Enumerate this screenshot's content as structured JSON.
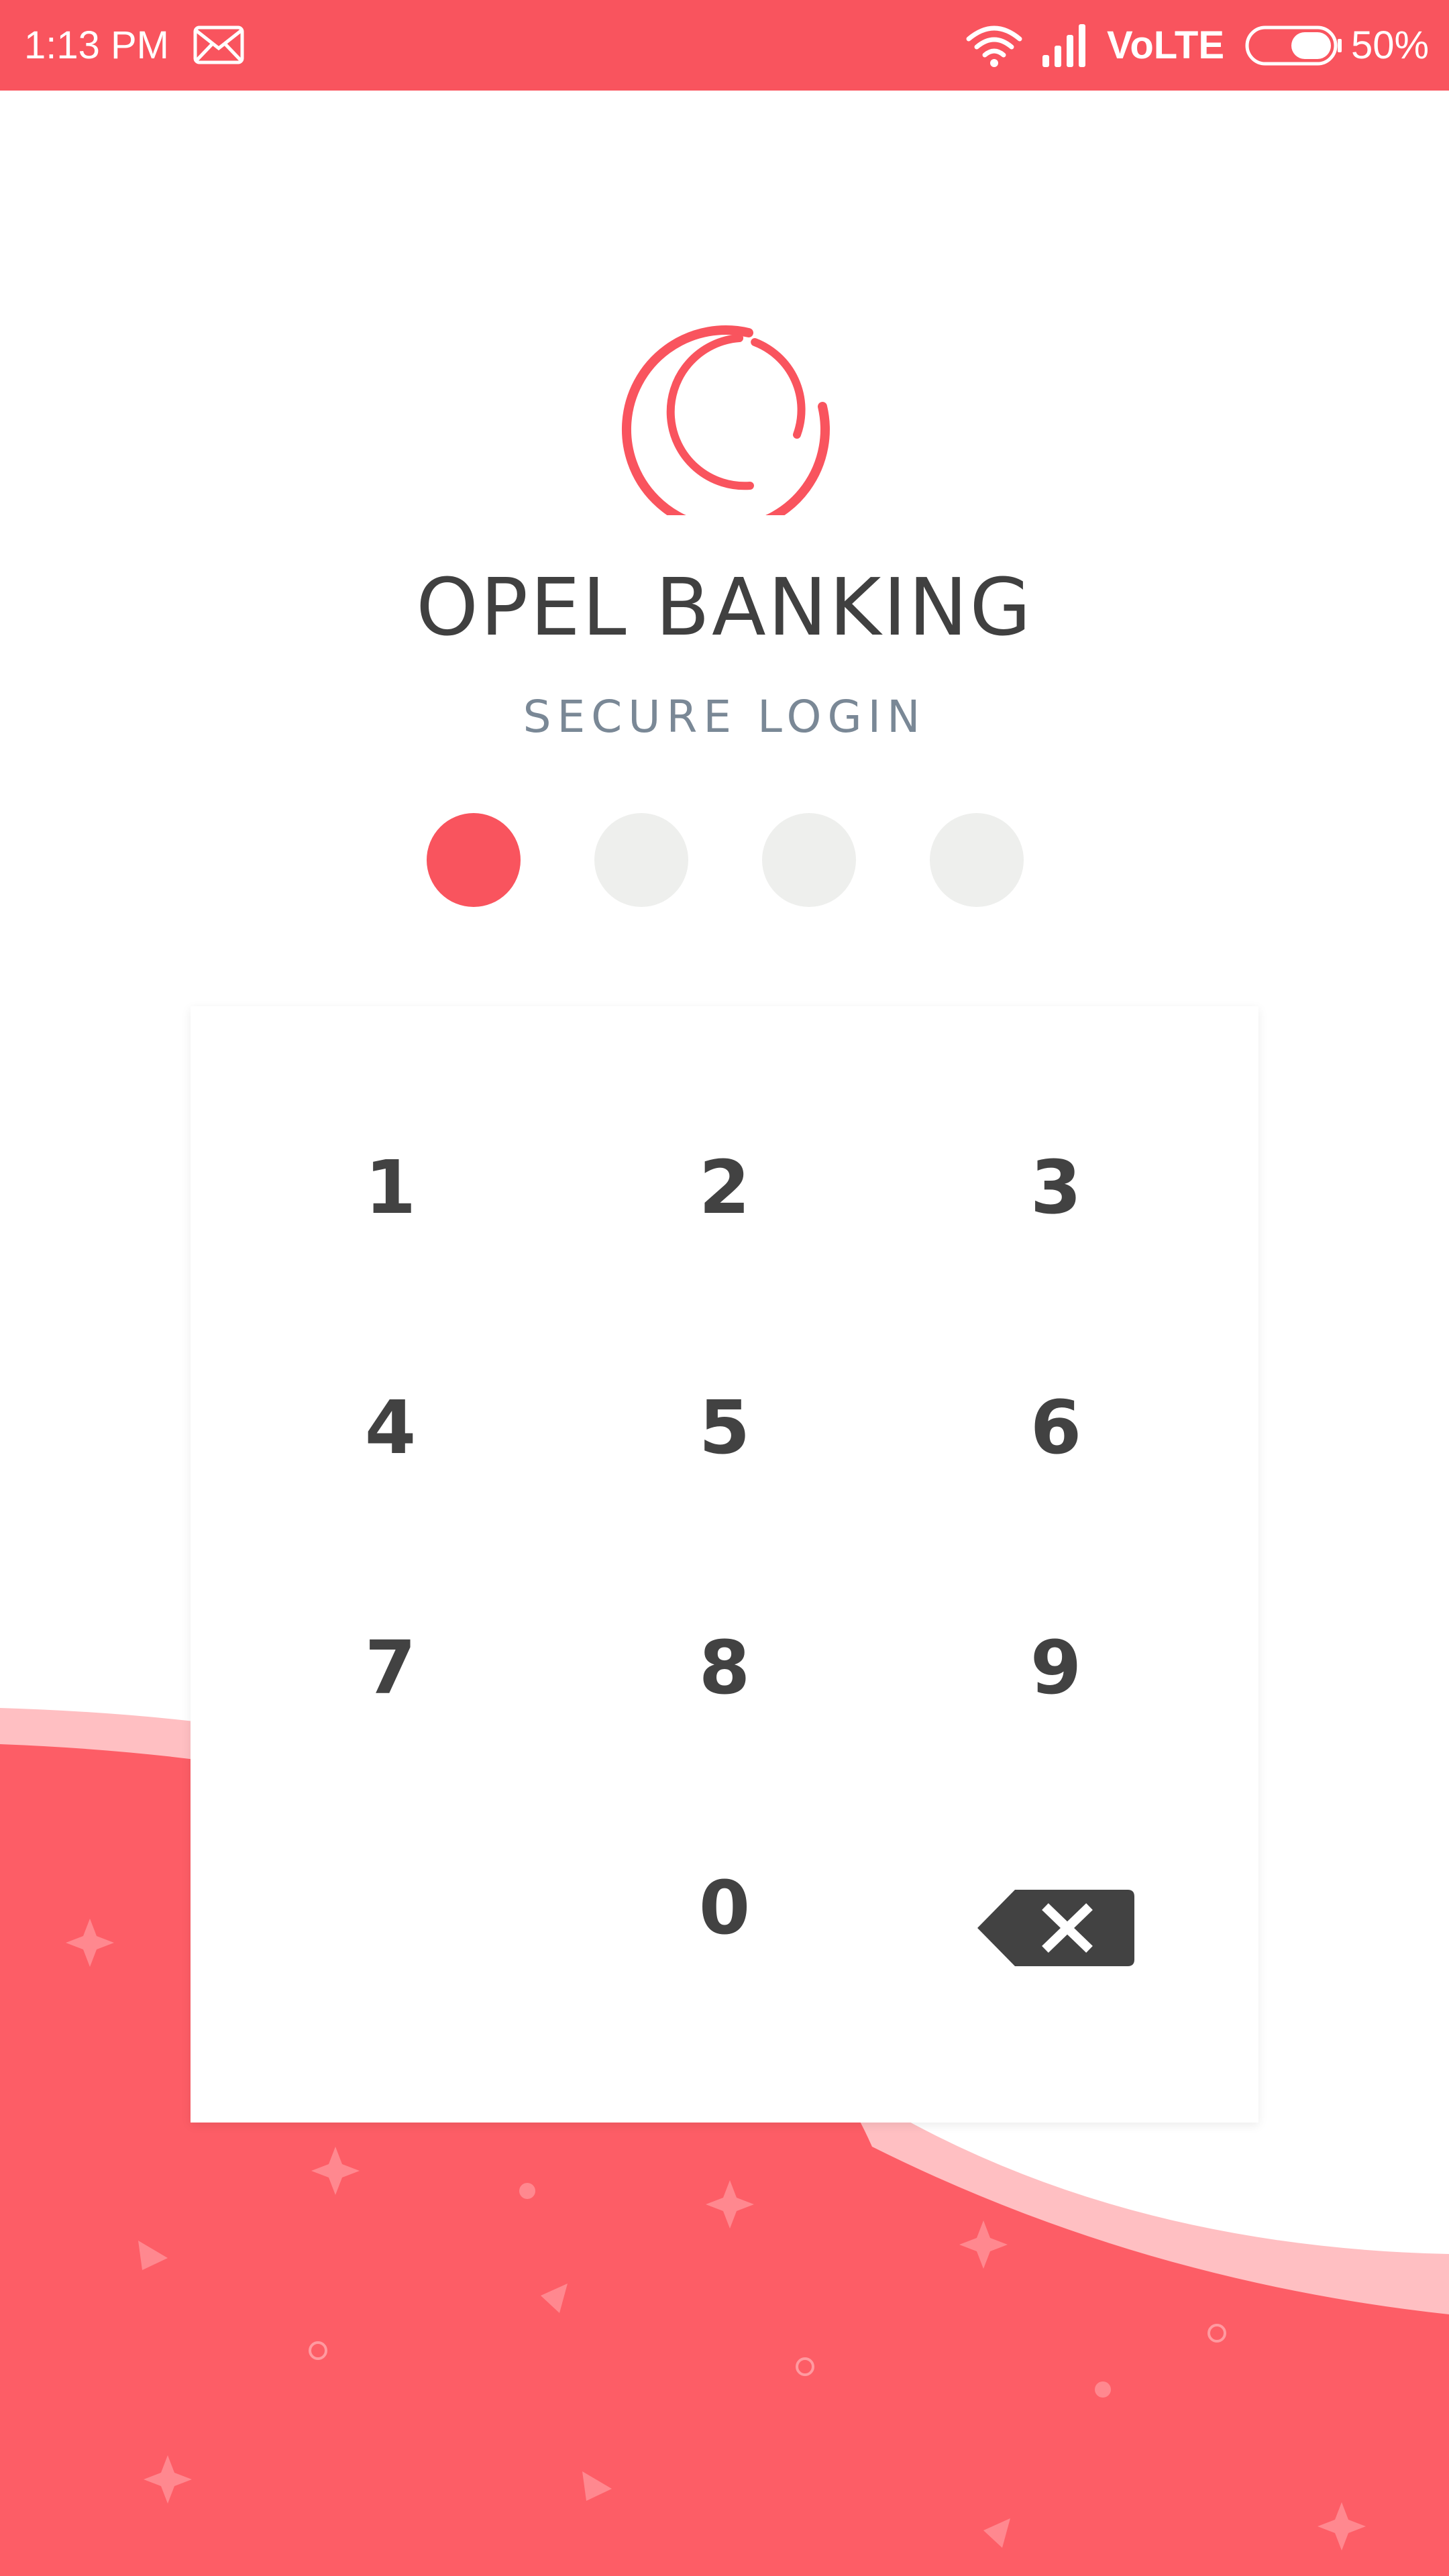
{
  "status_bar": {
    "time": "1:13 PM",
    "network": "VoLTE",
    "battery_percent": "50%",
    "battery_level": 0.5,
    "icons": [
      "mail-icon",
      "wifi-icon",
      "signal-icon",
      "battery-icon"
    ]
  },
  "app": {
    "title": "OPEL BANKING",
    "subtitle": "SECURE LOGIN"
  },
  "pin": {
    "length": 4,
    "entered": 1
  },
  "keypad": {
    "keys": {
      "k1": "1",
      "k2": "2",
      "k3": "3",
      "k4": "4",
      "k5": "5",
      "k6": "6",
      "k7": "7",
      "k8": "8",
      "k9": "9",
      "k0": "0"
    },
    "backspace_icon": "backspace-icon"
  },
  "colors": {
    "accent": "#f9545e",
    "text_dark": "#424242",
    "text_muted": "#7a8896",
    "dot_empty": "#eeefed"
  }
}
